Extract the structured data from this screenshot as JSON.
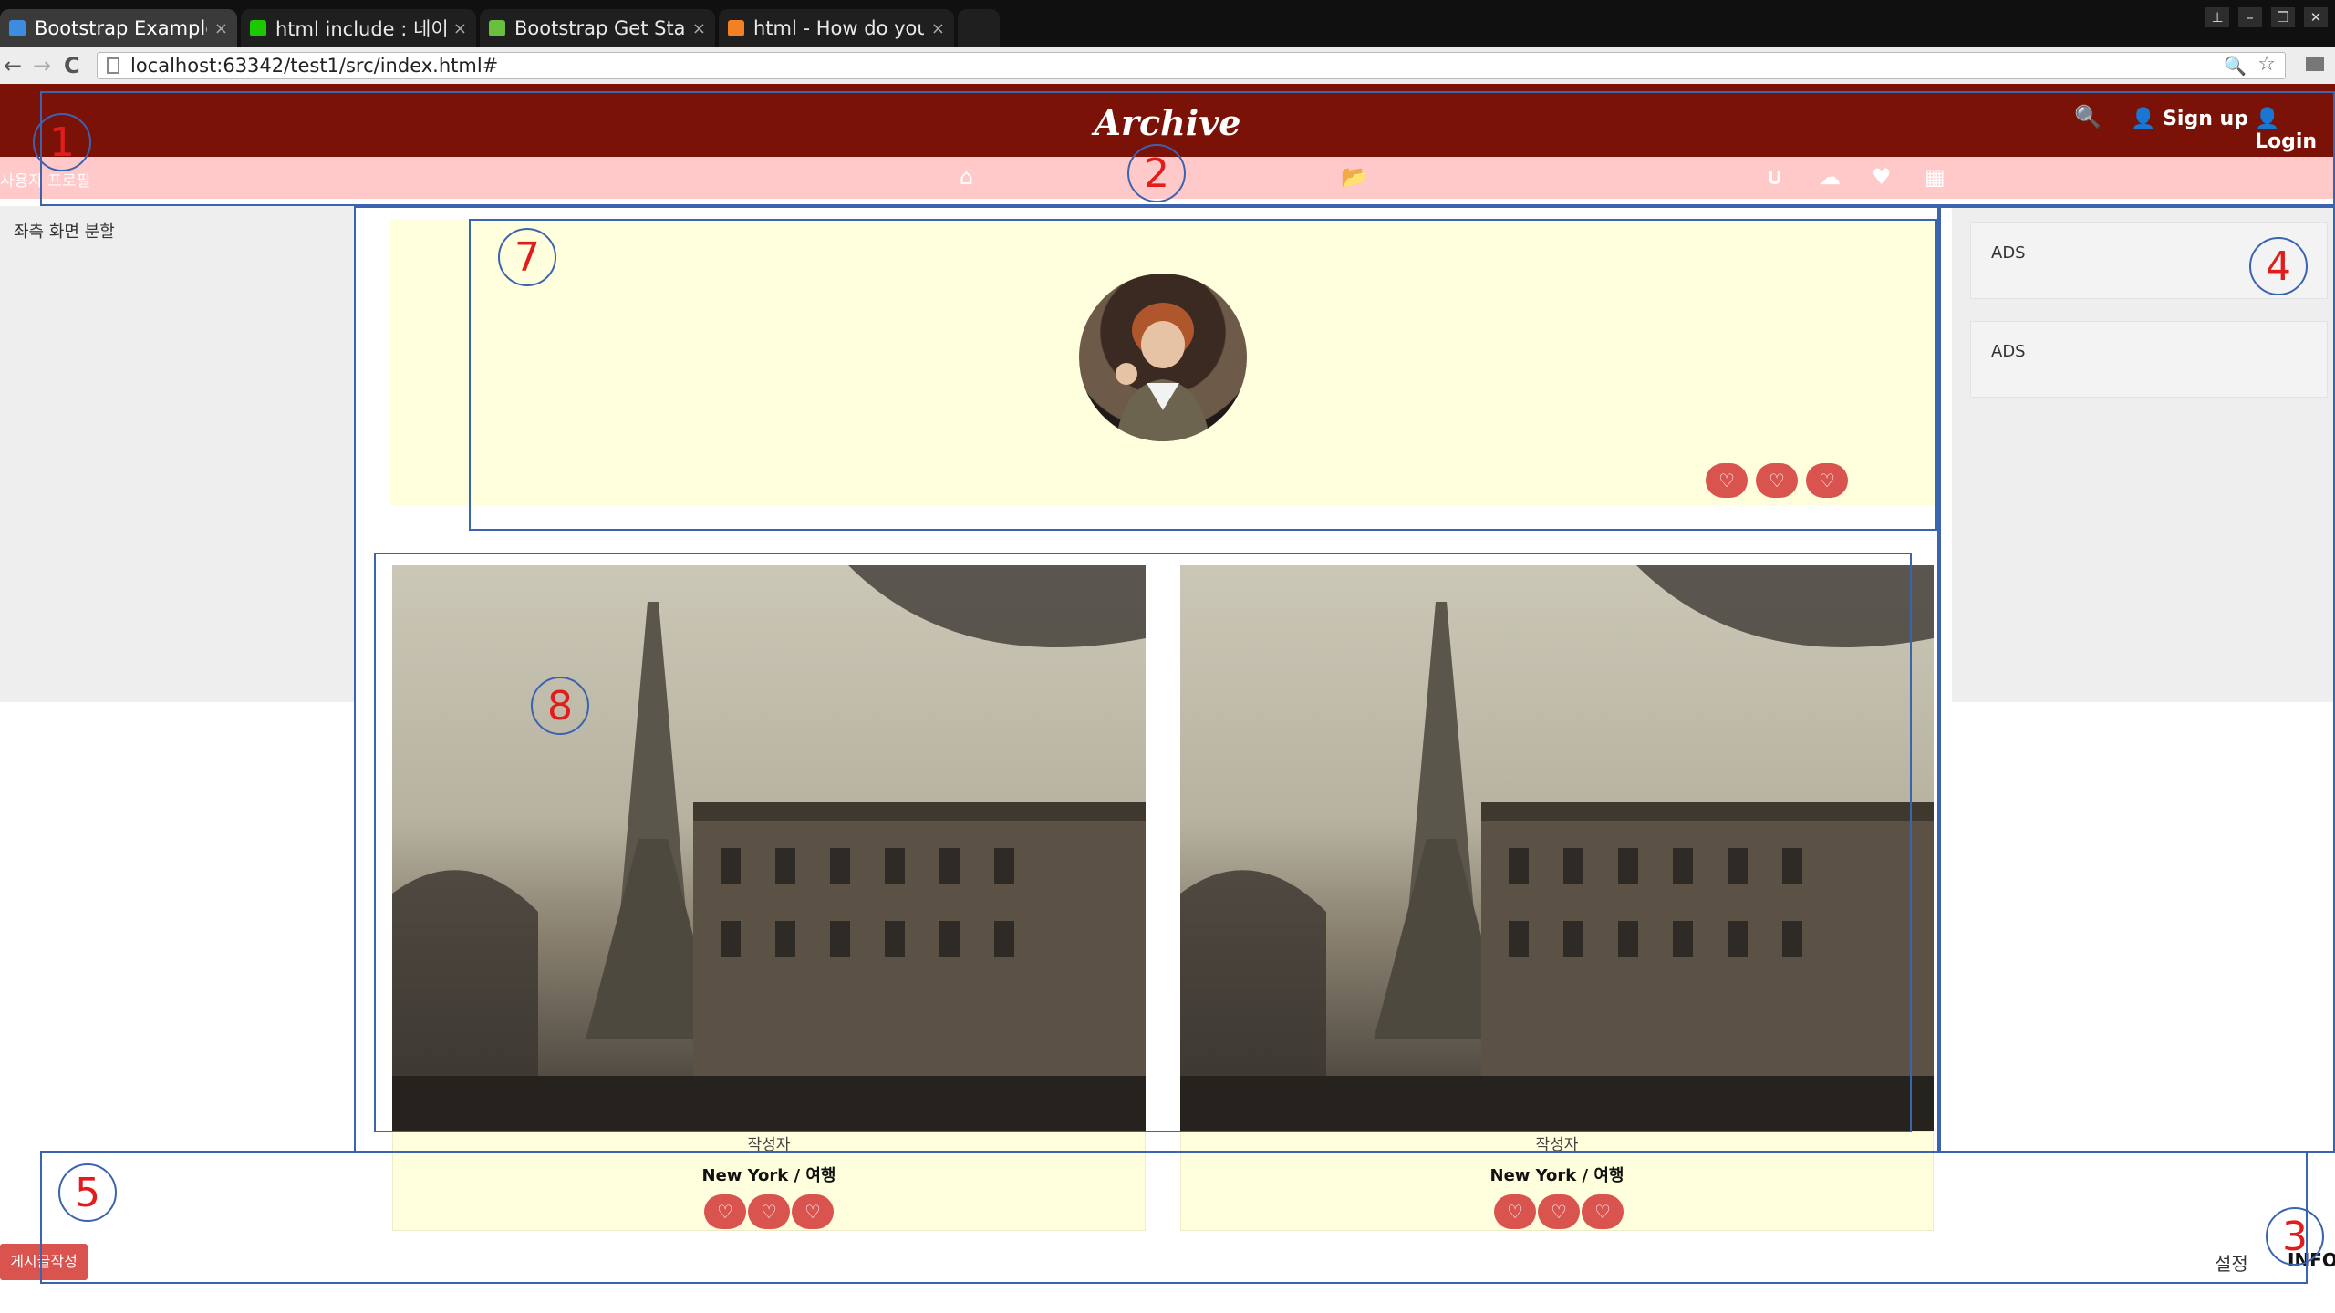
{
  "browser": {
    "tabs": [
      {
        "title": "Bootstrap Example",
        "fav_color": "#3c8de0",
        "active": true
      },
      {
        "title": "html include : 네이버",
        "fav_color": "#1ec800",
        "active": false
      },
      {
        "title": "Bootstrap Get Starte",
        "fav_color": "#6bbf3f",
        "active": false
      },
      {
        "title": "html - How do you",
        "fav_color": "#f48024",
        "active": false
      }
    ],
    "close_label": "×",
    "url": "localhost:63342/test1/src/index.html#",
    "back_icon": "←",
    "forward_icon": "→",
    "reload_icon": "C",
    "zoom_icon": "🔍",
    "star_icon": "☆"
  },
  "header": {
    "logo": "Archive",
    "search_icon": "🔍",
    "signup": "Sign up",
    "login": "Login",
    "user_icon": "👤"
  },
  "subbar": {
    "profile": "사용자 프로필",
    "home_icon": "⌂",
    "folder_icon": "📂",
    "magnet_icon": "∪",
    "cloud_icon": "☁",
    "heart_icon": "♥",
    "grid_icon": "▦"
  },
  "left_panel": {
    "text": "좌측 화면 분할"
  },
  "right_panel": {
    "ads": [
      "ADS",
      "ADS"
    ]
  },
  "cards": [
    {
      "author": "작성자",
      "place": "New York / 여행"
    },
    {
      "author": "작성자",
      "place": "New York / 여행"
    }
  ],
  "heart_glyph": "♡",
  "footer": {
    "write": "게시글작성",
    "settings": "설정",
    "info": "INFO"
  },
  "annotations": [
    "1",
    "2",
    "3",
    "4",
    "5",
    "7",
    "8"
  ],
  "colors": {
    "brand": "#7a1207",
    "pink": "#ffc9c9",
    "accent": "#d9534f",
    "card": "#ffffdd",
    "annotation": "#3b63b0",
    "annotation_num": "#e21c1c"
  }
}
